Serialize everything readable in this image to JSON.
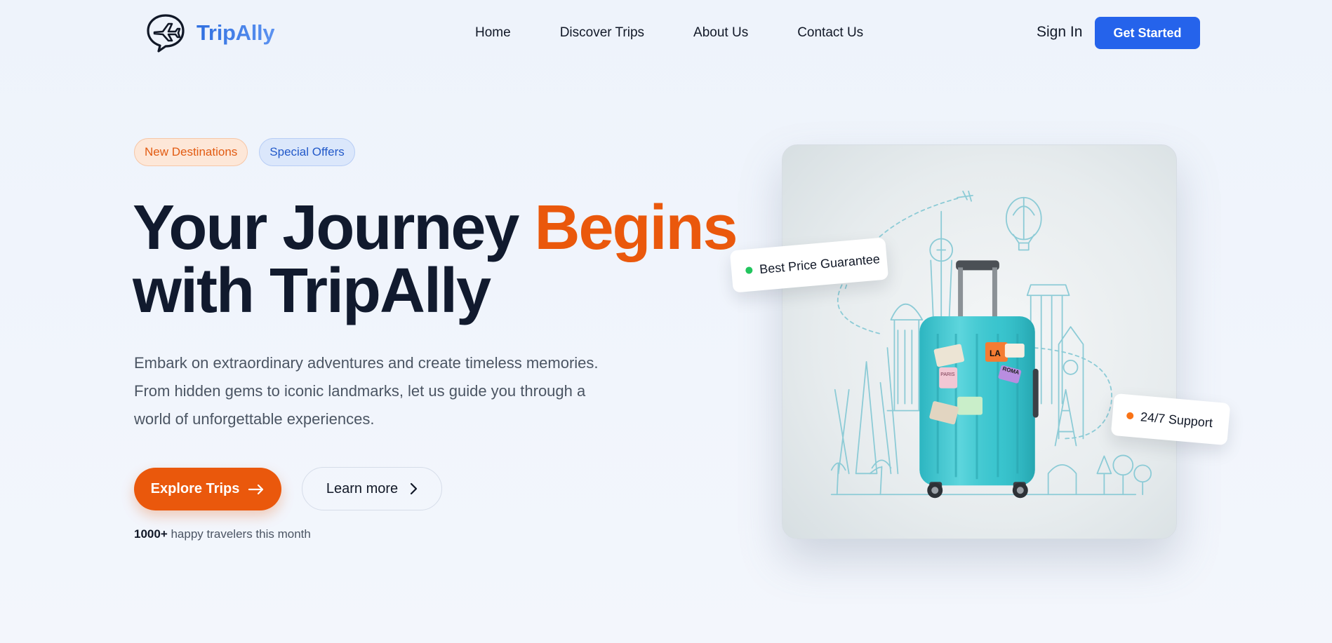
{
  "brand": {
    "name": "TripAlly"
  },
  "nav": {
    "links": [
      {
        "label": "Home"
      },
      {
        "label": "Discover Trips"
      },
      {
        "label": "About Us"
      },
      {
        "label": "Contact Us"
      }
    ],
    "sign_in": "Sign In",
    "get_started": "Get Started"
  },
  "hero": {
    "badges": [
      "New Destinations",
      "Special Offers"
    ],
    "headline_part1": "Your Journey ",
    "headline_accent": "Begins",
    "headline_part2": "with TripAlly",
    "subtext": "Embark on extraordinary adventures and create timeless memories. From hidden gems to iconic landmarks, let us guide you through a world of unforgettable experiences.",
    "primary_button": "Explore Trips",
    "secondary_button": "Learn more",
    "social_count": "1000+",
    "social_text": " happy travelers this month"
  },
  "image": {
    "sticker_la": "LA",
    "sticker_roma": "ROMA",
    "sticker_paris": "PARIS"
  },
  "floating_cards": {
    "price": "Best Price Guarantee",
    "support": "24/7 Support"
  },
  "colors": {
    "primary_blue": "#2563eb",
    "accent_orange": "#ea580c",
    "heading": "#111a2e",
    "suitcase": "#3cc7d0"
  }
}
